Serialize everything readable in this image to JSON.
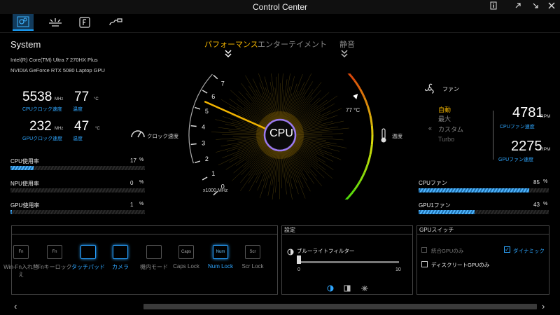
{
  "window": {
    "title": "Control Center"
  },
  "nav": {
    "tabs": [
      "system-icon",
      "display-icon",
      "keyboard-icon",
      "connection-icon"
    ]
  },
  "modes": {
    "performance": "パフォーマンス",
    "entertainment": "エンターテイメント",
    "silent": "静音"
  },
  "system": {
    "heading": "System",
    "cpu_name": "Intel(R) Core(TM) Ultra 7 270HX Plus",
    "gpu_name": "NVIDIA GeForce RTX 5080 Laptop GPU",
    "cpu_clock": "5538",
    "cpu_clock_unit": "MHz",
    "cpu_clock_label": "CPUクロック速度",
    "cpu_temp": "77",
    "cpu_temp_unit": "°C",
    "cpu_temp_label": "温度",
    "gpu_clock": "232",
    "gpu_clock_unit": "MHz",
    "gpu_clock_label": "GPUクロック速度",
    "gpu_temp": "47",
    "gpu_temp_unit": "°C",
    "gpu_temp_label": "温度"
  },
  "usage": [
    {
      "label": "CPU使用率",
      "value": "17",
      "unit": "%",
      "fraction": 0.17
    },
    {
      "label": "NPU使用率",
      "value": "0",
      "unit": "%",
      "fraction": 0.0
    },
    {
      "label": "GPU使用率",
      "value": "1",
      "unit": "%",
      "fraction": 0.01
    }
  ],
  "gauge": {
    "center": "CPU",
    "ticks": [
      "0",
      "1",
      "2",
      "3",
      "4",
      "5",
      "6",
      "7"
    ],
    "unit": "x1000 MHz",
    "clock_label": "クロック速度",
    "temp_label": "温度",
    "temp_value": "77 °C",
    "clock_value_khz": 5.5
  },
  "fan": {
    "title": "ファン",
    "modes": [
      "自動",
      "最大",
      "カスタム",
      "Turbo"
    ],
    "cpu_rpm": "4781",
    "cpu_rpm_unit": "RPM",
    "cpu_label": "CPUファン速度",
    "gpu_rpm": "2275",
    "gpu_rpm_unit": "RPM",
    "gpu_label": "GPUファン速度",
    "cpu_fan": {
      "label": "CPUファン",
      "value": "85",
      "unit": "%",
      "fraction": 0.85
    },
    "gpu_fan": {
      "label": "GPU1ファン",
      "value": "43",
      "unit": "%",
      "fraction": 0.43
    }
  },
  "keys": [
    {
      "key": "Fn",
      "label": "Win-Fn入れ替え",
      "on": false
    },
    {
      "key": "Fn",
      "label": "Fnキーロック",
      "on": false
    },
    {
      "key": "",
      "label": "タッチパッド",
      "on": true
    },
    {
      "key": "",
      "label": "カメラ",
      "on": true
    },
    {
      "key": "",
      "label": "機内モード",
      "on": false
    },
    {
      "key": "Caps",
      "label": "Caps Lock",
      "on": false
    },
    {
      "key": "Num",
      "label": "Num Lock",
      "on": true
    },
    {
      "key": "Scr",
      "label": "Scr Lock",
      "on": false
    }
  ],
  "settings": {
    "title": "設定",
    "bluelight": "ブルーライトフィルター",
    "min": "0",
    "max": "10",
    "fraction": 0.0
  },
  "gpu_switch": {
    "title": "GPUスイッチ",
    "integrated": "統合GPUのみ",
    "dynamic": "ダイナミック",
    "discrete": "ディスクリートGPUのみ"
  }
}
